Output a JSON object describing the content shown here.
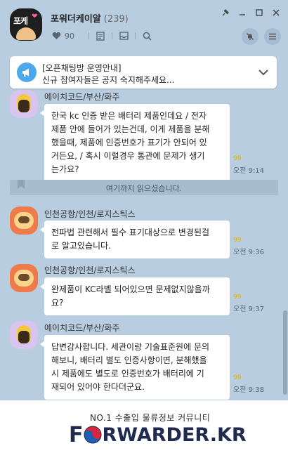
{
  "header": {
    "avatar_text": "포케",
    "title": "포워더케이알",
    "member_count": "(239)",
    "like_count": "90",
    "icons": [
      "heart-icon",
      "notice-board-icon",
      "inbox-icon",
      "search-icon",
      "mute-icon",
      "menu-icon"
    ]
  },
  "window": {
    "controls": [
      "pin",
      "minimize",
      "maximize",
      "close"
    ]
  },
  "notice": {
    "title": "[오픈채팅방 운영안내]",
    "subtitle": "신규 참여자들은 공지 숙지해주세요...",
    "accent_color": "#4aa8ec"
  },
  "messages": [
    {
      "sender": "에이치코드/부산/화주",
      "avatar": "kakao-friend-purple",
      "lines": [
        "한국 kc 인증 받은 배터리 제품인데요 /  전자",
        "제품 안에 들어가 있는건데, 이게 제품을 분해",
        "했을때, 제품에 인증번호가 표기가 안되어 있",
        "거든요, / 혹시 이럴경우 통관에 문제가 생기",
        "는가요?"
      ],
      "unread": "99",
      "time": "오전 9:14"
    },
    {
      "sender": "인천공항/인천/로지스틱스",
      "avatar": "kakao-friend-orange",
      "lines": [
        "전파법 관련해서 필수 표기대상으로 변경된걸",
        "로 알고있습니다."
      ],
      "unread": "99",
      "time": "오전 9:36"
    },
    {
      "sender": "인천공항/인천/로지스틱스",
      "avatar": "kakao-friend-orange",
      "lines": [
        "완제품이 KC라벨 되어있으면 문제없지않을까",
        "요?"
      ],
      "unread": "99",
      "time": "오전 9:37"
    },
    {
      "sender": "에이치코드/부산/화주",
      "avatar": "kakao-friend-purple",
      "lines": [
        "답변감사합니다. 세관이랑 기술표준원에 문의",
        "해보니, 배터리 별도 인증사항이면, 분해했을",
        "시 제품에도 별도로 인증번호가 배터리에 기",
        "재되어 있어야 한다더군요."
      ],
      "unread": "99",
      "time": "오전 9:38"
    }
  ],
  "divider": {
    "text": "여기까지 읽으셨습니다."
  },
  "brand": {
    "tagline": "NO.1 수출입 물류정보 커뮤니티",
    "logo_first": "F",
    "logo_rest": "RWARDER.KR",
    "colors": {
      "navy": "#1f2a4e",
      "red": "#d7263d",
      "blue": "#1d5fb4"
    }
  },
  "theme": {
    "chat_background": "#b9cde0",
    "unread_color": "#e3b400"
  }
}
